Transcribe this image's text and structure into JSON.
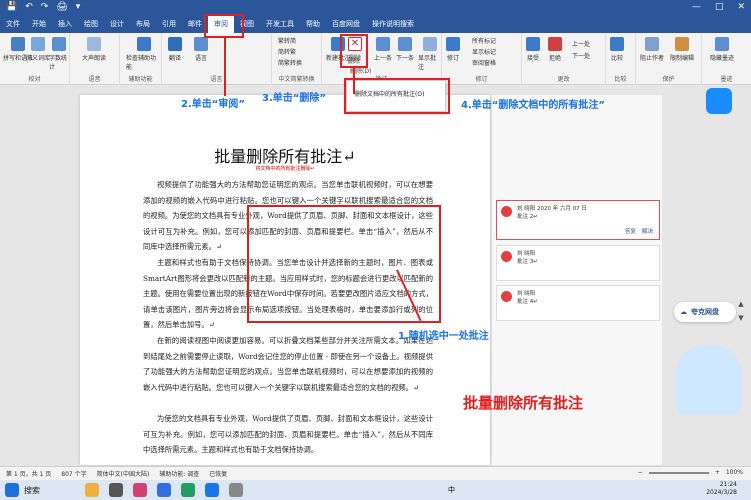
{
  "quick_access": [
    "💾",
    "↶",
    "↷",
    "🖨",
    "▾"
  ],
  "window_controls": [
    "—",
    "□",
    "✕"
  ],
  "menu": [
    "文件",
    "开始",
    "插入",
    "绘图",
    "设计",
    "布局",
    "引用",
    "邮件",
    "审阅",
    "视图",
    "开发工具",
    "帮助",
    "百度网盘",
    "操作说明搜索"
  ],
  "active_menu": "审阅",
  "ribbon": {
    "proofing": {
      "label": "校对",
      "items": [
        "拼写和语法",
        "同义词库",
        "字数统计"
      ]
    },
    "speech": {
      "label": "语音",
      "items": [
        "大声朗读"
      ]
    },
    "accessibility": {
      "label": "辅助功能",
      "items": [
        "检查辅助功能"
      ]
    },
    "language": {
      "label": "语言",
      "items": [
        "翻译",
        "语言"
      ]
    },
    "chinese": {
      "label": "中文简繁转换",
      "items": [
        "繁转简",
        "简转繁",
        "简繁转换"
      ]
    },
    "comments": {
      "label": "批注",
      "items": [
        "新建批注",
        "删除",
        "上一条",
        "下一条",
        "显示批注"
      ]
    },
    "tracking": {
      "label": "修订",
      "items": [
        "修订",
        "所有标记",
        "显示标记",
        "审阅窗格"
      ]
    },
    "changes": {
      "label": "更改",
      "items": [
        "接受",
        "拒绝",
        "上一处",
        "下一处"
      ]
    },
    "compare": {
      "label": "比较",
      "items": [
        "比较"
      ]
    },
    "protect": {
      "label": "保护",
      "items": [
        "阻止作者",
        "限制编辑"
      ]
    },
    "ink": {
      "label": "墨迹",
      "items": [
        "隐藏墨迹"
      ]
    }
  },
  "delete_menu": {
    "items": [
      "删除",
      "删除(D)",
      "删除文档中的所有批注(O)"
    ]
  },
  "annotations": {
    "step1": "1.随机选中一处批注",
    "step2": "2.单击“审阅”",
    "step3": "3.单击“删除”",
    "step4": "4.单击“删除文档中的所有批注”",
    "headline": "批量删除所有批注"
  },
  "document": {
    "title": "批量删除所有批注↵",
    "subtitle": "将文档中的所有批注删除↵",
    "paragraphs": [
      "视频提供了功能强大的方法帮助您证明您的观点。当您单击联机视频时，可以在想要添加的视频的嵌入代码中进行粘贴。您也可以键入一个关键字以联机搜索最适合您的文档的视频。为使您的文档具有专业外观，Word提供了页眉、页脚、封面和文本框设计，这些设计可互为补充。例如，您可以添加匹配的封面、页眉和提要栏。单击“插入”，然后从不同库中选择所需元素。↵",
      "主题和样式也有助于文档保持协调。当您单击设计并选择新的主题时，图片、图表或SmartArt图形将会更改以匹配新的主题。当应用样式时，您的标题会进行更改以匹配新的主题。使用在需要位置出现的新按钮在Word中保存时间。若要更改图片适应文档的方式，请单击该图片，图片旁边将会显示布局选项按钮。当处理表格时，单击要添加行或列的位置，然后单击加号。↵",
      "在新的阅读视图中阅读更加容易。可以折叠文档某些部分并关注所需文本。如果在达到结尾处之前需要停止读取，Word会记住您的停止位置 - 即使在另一个设备上。视频提供了功能强大的方法帮助您证明您的观点。当您单击联机视频时，可以在想要添加的视频的嵌入代码中进行粘贴。您也可以键入一个关键字以联机搜索最适合您的文档的视频。↵",
      "为使您的文档具有专业外观，Word提供了页眉、页脚、封面和文本框设计，这些设计可互为补充。例如，您可以添加匹配的封面、页眉和提要栏。单击“插入”，然后从不同库中选择所需元素。主题和样式也有助于文档保持协调。"
    ]
  },
  "comments": [
    {
      "author": "刘 晓阳",
      "date": "2020 年 六月 07 日",
      "text": "批注 2↵",
      "reply": "答复",
      "resolve": "解决"
    },
    {
      "author": "刘 晓阳",
      "date": "",
      "text": "批注 3↵"
    },
    {
      "author": "刘 晓阳",
      "date": "",
      "text": "批注 4↵"
    }
  ],
  "status": {
    "page": "第 1 页，共 1 页",
    "words": "807 个字",
    "lang": "简体中文(中国大陆)",
    "access": "辅助功能: 调查",
    "track": "已恢复",
    "zoom": "100%"
  },
  "taskbar": {
    "search": "搜索",
    "time": "21:24",
    "date": "2024/3/28",
    "lang": "中"
  },
  "side_widget": "夸克网盘",
  "colors": {
    "brand": "#2b579a",
    "annotation_red": "#e02020",
    "annotation_blue": "#1a73e8"
  }
}
